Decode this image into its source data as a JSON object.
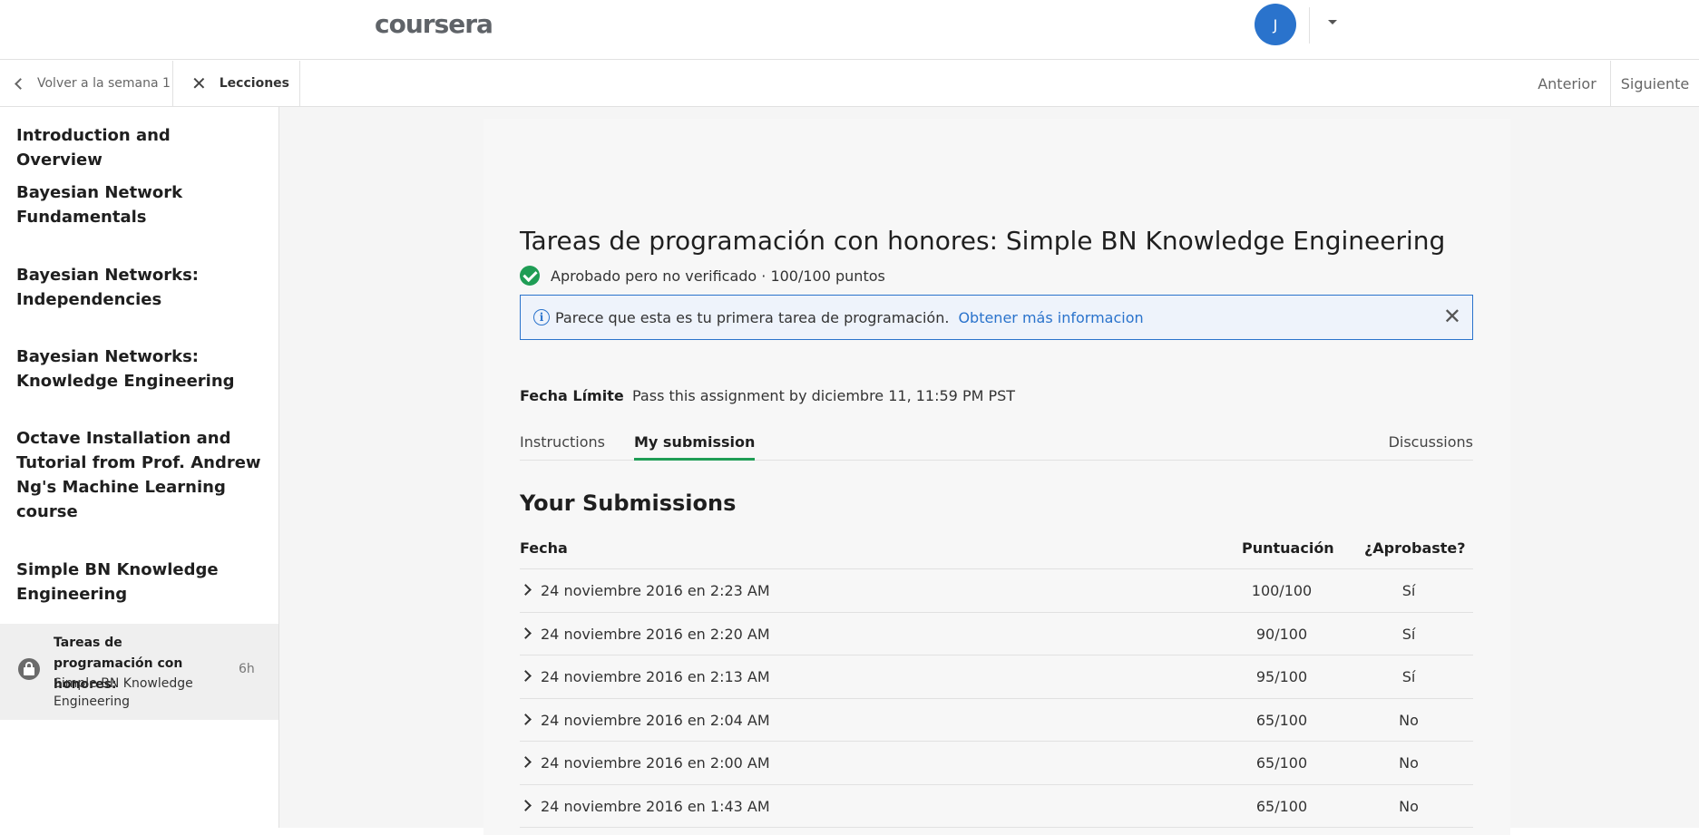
{
  "header": {
    "logo": "coursera",
    "avatar_initial": "J"
  },
  "subnav": {
    "back_label": "Volver a la semana 1",
    "lessons_label": "Lecciones",
    "prev_label": "Anterior",
    "next_label": "Siguiente"
  },
  "sidebar": {
    "items": [
      "Introduction and Overview",
      "Bayesian Network Fundamentals",
      "Bayesian Networks: Independencies",
      "Bayesian Networks: Knowledge Engineering",
      "Octave Installation and Tutorial from Prof. Andrew Ng's Machine Learning course",
      "Simple BN Knowledge Engineering"
    ],
    "active": {
      "title": "Tareas de programación con honores:",
      "subtitle": "Simple BN Knowledge Engineering",
      "time": "6h"
    }
  },
  "main": {
    "title": "Tareas de programación con honores: Simple BN Knowledge Engineering",
    "status": "Aprobado pero no verificado · 100/100 puntos",
    "info": {
      "text": "Parece que esta es tu primera tarea de programación.",
      "link": "Obtener más informacion"
    },
    "deadline": {
      "label": "Fecha Límite",
      "value": "Pass this assignment by diciembre 11, 11:59 PM PST"
    },
    "tabs": {
      "instructions": "Instructions",
      "submission": "My submission",
      "discussions": "Discussions"
    },
    "submissions_heading": "Your Submissions",
    "table": {
      "headers": {
        "date": "Fecha",
        "score": "Puntuación",
        "passed": "¿Aprobaste?"
      },
      "rows": [
        {
          "date": "24 noviembre 2016 en 2:23 AM",
          "score": "100/100",
          "passed": "Sí"
        },
        {
          "date": "24 noviembre 2016 en 2:20 AM",
          "score": "90/100",
          "passed": "Sí"
        },
        {
          "date": "24 noviembre 2016 en 2:13 AM",
          "score": "95/100",
          "passed": "Sí"
        },
        {
          "date": "24 noviembre 2016 en 2:04 AM",
          "score": "65/100",
          "passed": "No"
        },
        {
          "date": "24 noviembre 2016 en 2:00 AM",
          "score": "65/100",
          "passed": "No"
        },
        {
          "date": "24 noviembre 2016 en 1:43 AM",
          "score": "65/100",
          "passed": "No"
        }
      ]
    }
  },
  "colors": {
    "accent_blue": "#2a73cc",
    "success_green": "#1f9d55"
  }
}
